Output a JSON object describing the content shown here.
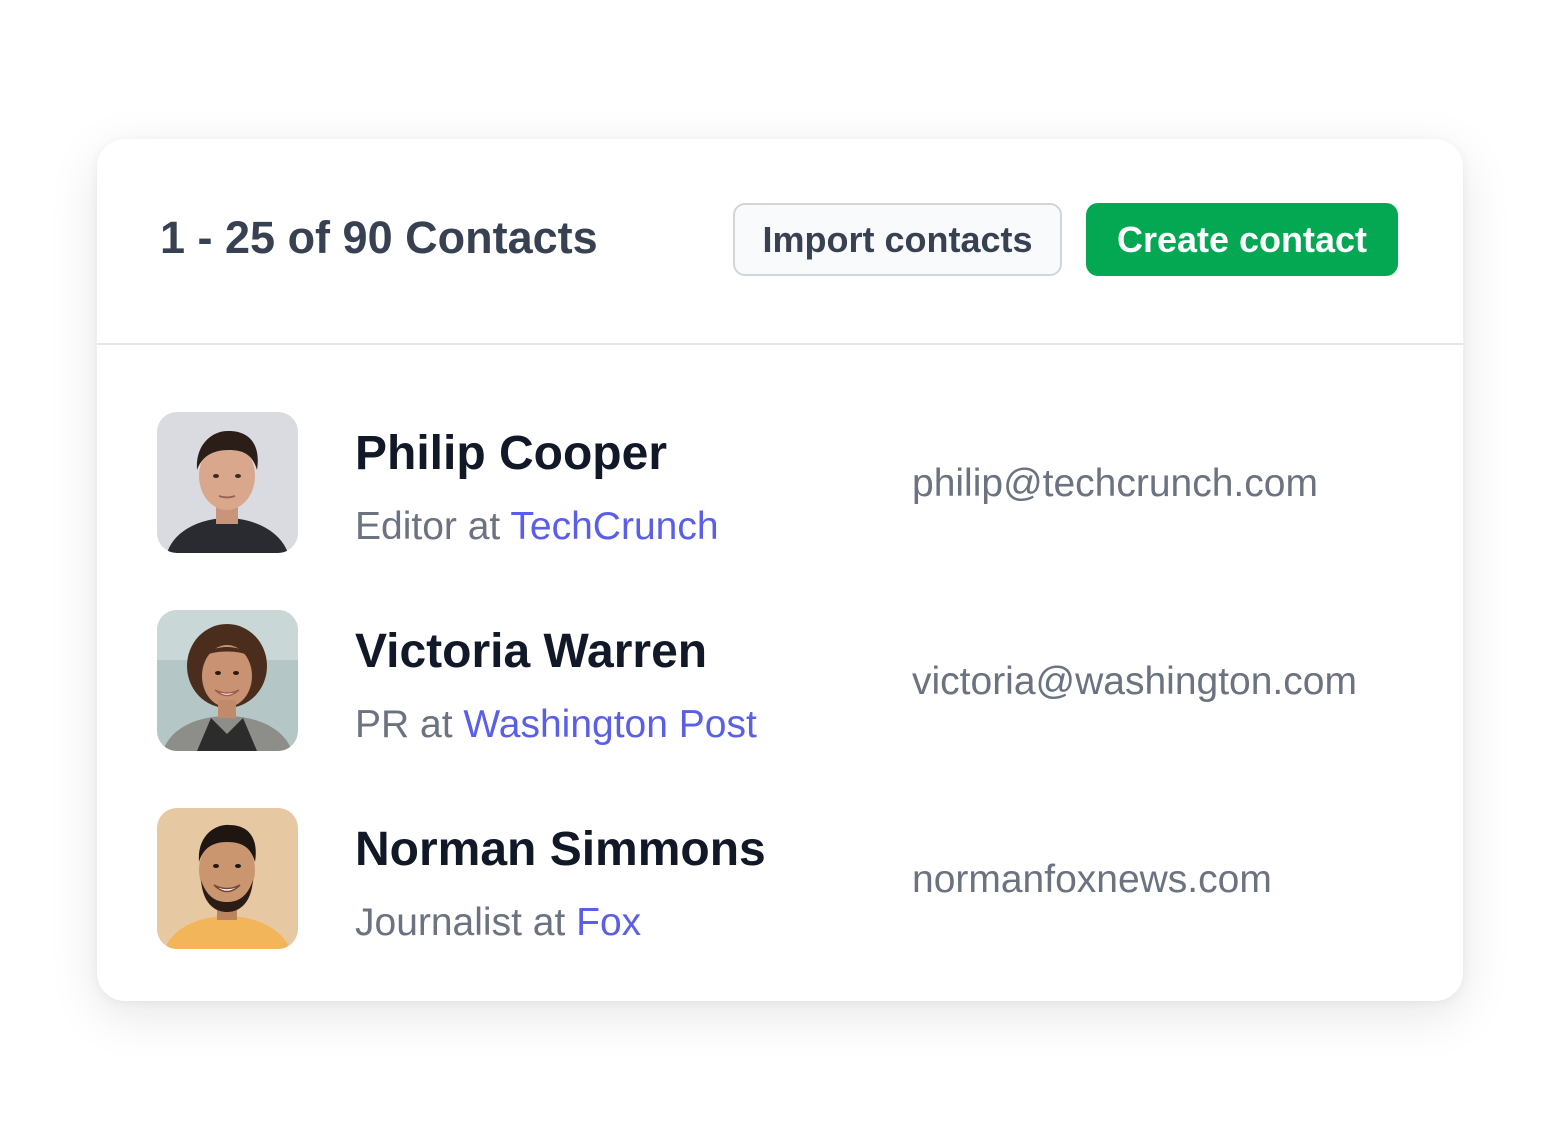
{
  "header": {
    "title": "1 - 25 of 90 Contacts",
    "import_label": "Import contacts",
    "create_label": "Create contact"
  },
  "colors": {
    "create_button_bg": "#04a852",
    "company_link": "#5b5fe8",
    "secondary_text": "#6b7280",
    "primary_text": "#111827"
  },
  "contacts": [
    {
      "name": "Philip Cooper",
      "role": "Editor",
      "at": "at",
      "company": "TechCrunch",
      "email": "philip@techcrunch.com",
      "avatar": "photo-man-short-dark-hair"
    },
    {
      "name": "Victoria Warren",
      "role": "PR",
      "at": "at",
      "company": "Washington Post",
      "email": "victoria@washington.com",
      "avatar": "photo-woman-curly-hair"
    },
    {
      "name": "Norman Simmons",
      "role": "Journalist",
      "at": "at",
      "company": "Fox",
      "email": "normanfoxnews.com",
      "avatar": "photo-man-beard-smiling"
    }
  ]
}
